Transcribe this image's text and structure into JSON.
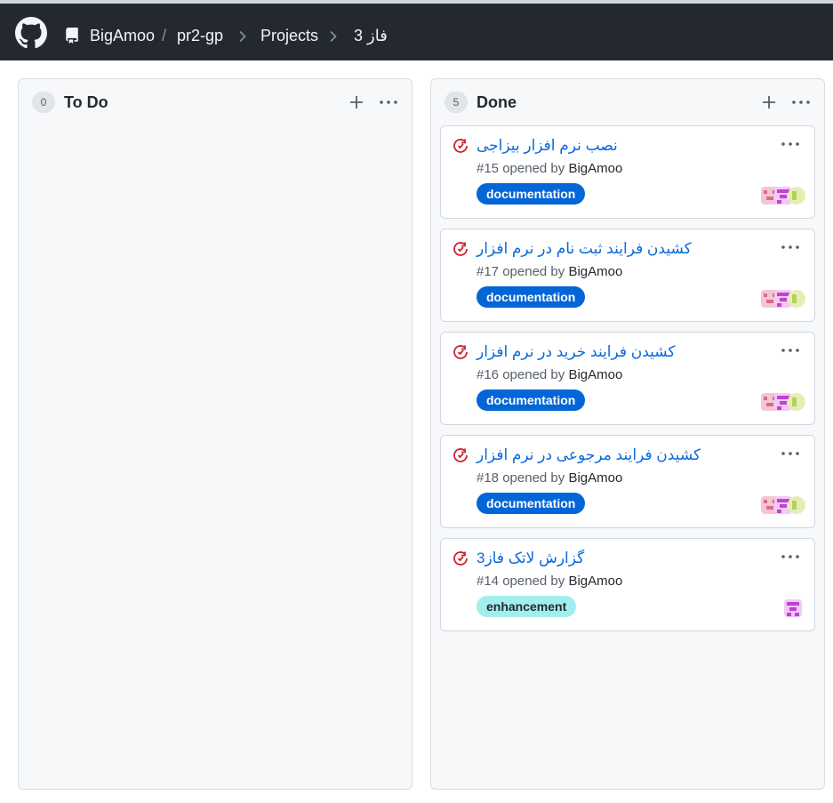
{
  "header": {
    "owner": "BigAmoo",
    "slash": "/",
    "repo": "pr2-gp",
    "projects": "Projects",
    "project_name": "فاز 3"
  },
  "columns": [
    {
      "count": "0",
      "title": "To Do",
      "cards": []
    },
    {
      "count": "5",
      "title": "Done",
      "cards": [
        {
          "title": "نصب نرم افزار بیزاجی",
          "number": "#15",
          "opened_by": "opened by",
          "author": "BigAmoo",
          "label": "documentation",
          "label_bg": "#0366d6",
          "label_fg": "#ffffff",
          "avatar": "group"
        },
        {
          "title": "کشیدن فرایند ثبت نام در نرم افزار",
          "number": "#17",
          "opened_by": "opened by",
          "author": "BigAmoo",
          "label": "documentation",
          "label_bg": "#0366d6",
          "label_fg": "#ffffff",
          "avatar": "group"
        },
        {
          "title": "کشیدن فرایند خرید در نرم افزار",
          "number": "#16",
          "opened_by": "opened by",
          "author": "BigAmoo",
          "label": "documentation",
          "label_bg": "#0366d6",
          "label_fg": "#ffffff",
          "avatar": "group"
        },
        {
          "title": "کشیدن فرایند مرجوعی در نرم افزار",
          "number": "#18",
          "opened_by": "opened by",
          "author": "BigAmoo",
          "label": "documentation",
          "label_bg": "#0366d6",
          "label_fg": "#ffffff",
          "avatar": "group"
        },
        {
          "title": "گزارش لاتک فاز3",
          "number": "#14",
          "opened_by": "opened by",
          "author": "BigAmoo",
          "label": "enhancement",
          "label_bg": "#a2eeef",
          "label_fg": "#24292f",
          "avatar": "single"
        }
      ]
    }
  ],
  "colors": {
    "header_bg": "#24292f",
    "column_bg": "#f6f8fa",
    "link": "#0969da",
    "issue_closed_icon": "#cf222e"
  },
  "icons": {
    "logo": "github-logo-icon",
    "repo": "repo-icon",
    "chevron": "chevron-right-icon",
    "plus": "plus-icon",
    "kebab": "kebab-horizontal-icon",
    "issue": "issue-closed-icon"
  }
}
